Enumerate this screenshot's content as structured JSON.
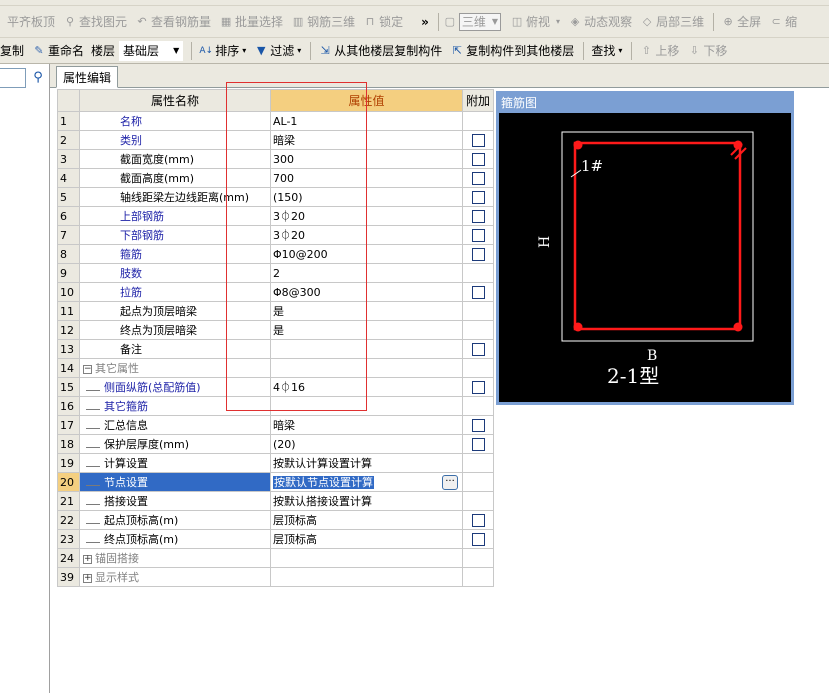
{
  "menu": [],
  "toolbar1": {
    "items": [
      {
        "label": "平齐板顶",
        "icon": "align-top-icon"
      },
      {
        "label": "查找图元",
        "icon": "find-icon"
      },
      {
        "label": "查看钢筋量",
        "icon": "view-rebar-icon"
      },
      {
        "label": "批量选择",
        "icon": "batch-select-icon"
      },
      {
        "label": "钢筋三维",
        "icon": "rebar-3d-icon"
      },
      {
        "label": "锁定",
        "icon": "lock-icon"
      }
    ],
    "overflow": "»",
    "view_combo": "三维",
    "view_items": [
      {
        "label": "俯视",
        "icon": "top-view-icon"
      },
      {
        "label": "动态观察",
        "icon": "orbit-icon"
      },
      {
        "label": "局部三维",
        "icon": "local-3d-icon"
      },
      {
        "label": "全屏",
        "icon": "fullscreen-icon"
      },
      {
        "label": "缩",
        "icon": "zoom-icon"
      }
    ]
  },
  "toolbar2": {
    "copy_label": "复制",
    "rename_label": "重命名",
    "floor_label": "楼层",
    "floor_value": "基础层",
    "sort_label": "排序",
    "filter_label": "过滤",
    "copy_from_label": "从其他楼层复制构件",
    "copy_to_label": "复制构件到其他楼层",
    "find_label": "查找",
    "move_up_label": "上移",
    "move_down_label": "下移"
  },
  "tab": {
    "label": "属性编辑"
  },
  "table": {
    "headers": {
      "name": "属性名称",
      "value": "属性值",
      "extra": "附加"
    },
    "rows": [
      {
        "num": "1",
        "name": "名称",
        "value": "AL-1",
        "style": "blue",
        "check": false
      },
      {
        "num": "2",
        "name": "类别",
        "value": "暗梁",
        "style": "blue",
        "check": true
      },
      {
        "num": "3",
        "name": "截面宽度(mm)",
        "value": "300",
        "style": "black",
        "check": true
      },
      {
        "num": "4",
        "name": "截面高度(mm)",
        "value": "700",
        "style": "black",
        "check": true
      },
      {
        "num": "5",
        "name": "轴线距梁左边线距离(mm)",
        "value": "(150)",
        "style": "black",
        "check": true
      },
      {
        "num": "6",
        "name": "上部钢筋",
        "value": "3⏀20",
        "style": "blue",
        "check": true
      },
      {
        "num": "7",
        "name": "下部钢筋",
        "value": "3⏀20",
        "style": "blue",
        "check": true
      },
      {
        "num": "8",
        "name": "箍筋",
        "value": "Φ10@200",
        "style": "blue",
        "check": true
      },
      {
        "num": "9",
        "name": "肢数",
        "value": "2",
        "style": "blue",
        "check": false
      },
      {
        "num": "10",
        "name": "拉筋",
        "value": "Φ8@300",
        "style": "blue",
        "check": true
      },
      {
        "num": "11",
        "name": "起点为顶层暗梁",
        "value": "是",
        "style": "black",
        "check": false
      },
      {
        "num": "12",
        "name": "终点为顶层暗梁",
        "value": "是",
        "style": "black",
        "check": false
      },
      {
        "num": "13",
        "name": "备注",
        "value": "",
        "style": "black",
        "check": true
      },
      {
        "num": "14",
        "name": "其它属性",
        "value": "",
        "style": "gray",
        "check": false,
        "expander": "−"
      },
      {
        "num": "15",
        "name": "侧面纵筋(总配筋值)",
        "value": "4⏀16",
        "style": "blue",
        "check": true,
        "child": true
      },
      {
        "num": "16",
        "name": "其它箍筋",
        "value": "",
        "style": "blue",
        "check": false,
        "child": true
      },
      {
        "num": "17",
        "name": "汇总信息",
        "value": "暗梁",
        "style": "black",
        "check": true,
        "child": true
      },
      {
        "num": "18",
        "name": "保护层厚度(mm)",
        "value": "(20)",
        "style": "black",
        "check": true,
        "child": true
      },
      {
        "num": "19",
        "name": "计算设置",
        "value": "按默认计算设置计算",
        "style": "black",
        "check": false,
        "child": true
      },
      {
        "num": "20",
        "name": "节点设置",
        "value": "按默认节点设置计算",
        "style": "black",
        "check": false,
        "child": true,
        "selected": true
      },
      {
        "num": "21",
        "name": "搭接设置",
        "value": "按默认搭接设置计算",
        "style": "black",
        "check": false,
        "child": true
      },
      {
        "num": "22",
        "name": "起点顶标高(m)",
        "value": "层顶标高",
        "style": "black",
        "check": true,
        "child": true
      },
      {
        "num": "23",
        "name": "终点顶标高(m)",
        "value": "层顶标高",
        "style": "black",
        "check": true,
        "child": true
      },
      {
        "num": "24",
        "name": "锚固搭接",
        "value": "",
        "style": "gray",
        "check": false,
        "expander": "+"
      },
      {
        "num": "39",
        "name": "显示样式",
        "value": "",
        "style": "gray",
        "check": false,
        "expander": "+"
      }
    ],
    "more_button": "···"
  },
  "stirrup": {
    "title": "箍筋图",
    "rebar_label": "1#",
    "h_label": "H",
    "b_label": "B",
    "type_label": "2-1型",
    "colors": {
      "rebar": "#ff1a1a",
      "outline": "#ffffff",
      "bg": "#000000"
    }
  }
}
